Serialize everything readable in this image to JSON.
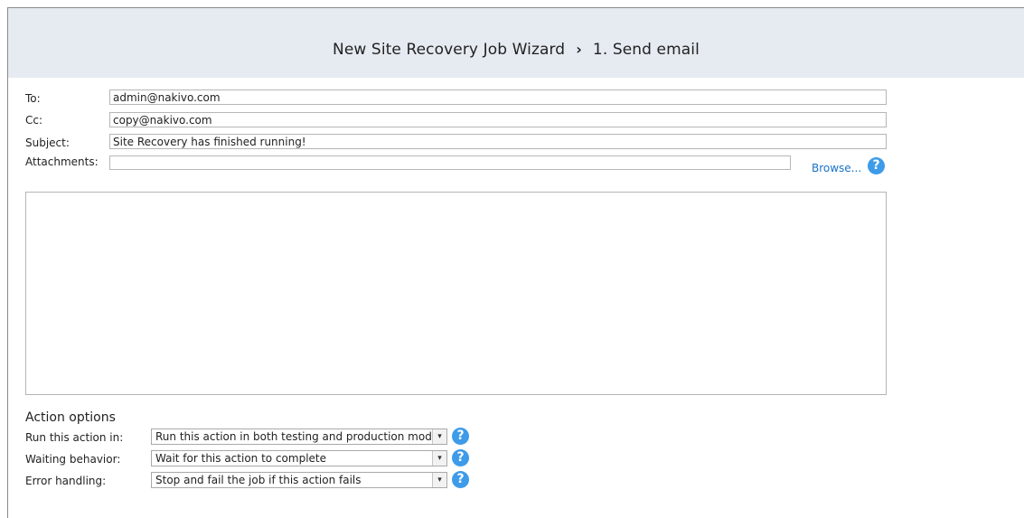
{
  "wizard": {
    "title": "New Site Recovery Job Wizard",
    "separator": "›",
    "step": "1. Send email"
  },
  "form": {
    "to_label": "To:",
    "to_value": "admin@nakivo.com",
    "cc_label": "Cc:",
    "cc_value": "copy@nakivo.com",
    "subject_label": "Subject:",
    "subject_value": "Site Recovery has finished running!",
    "attachments_label": "Attachments:",
    "attachments_value": "",
    "browse_label": "Browse...",
    "help_glyph": "?",
    "message_body": ""
  },
  "action_options": {
    "title": "Action options",
    "run_in_label": "Run this action in:",
    "run_in_value": "Run this action in both testing and production mode",
    "waiting_label": "Waiting behavior:",
    "waiting_value": "Wait for this action to complete",
    "error_label": "Error handling:",
    "error_value": "Stop and fail the job if this action fails",
    "dropdown_glyph": "▾"
  },
  "colors": {
    "header_bg": "#e6ebf2",
    "link": "#1a73c9",
    "help_icon": "#3d9be9"
  },
  "icons": [
    "chevron-right-icon",
    "help-icon",
    "dropdown-arrow-icon"
  ]
}
